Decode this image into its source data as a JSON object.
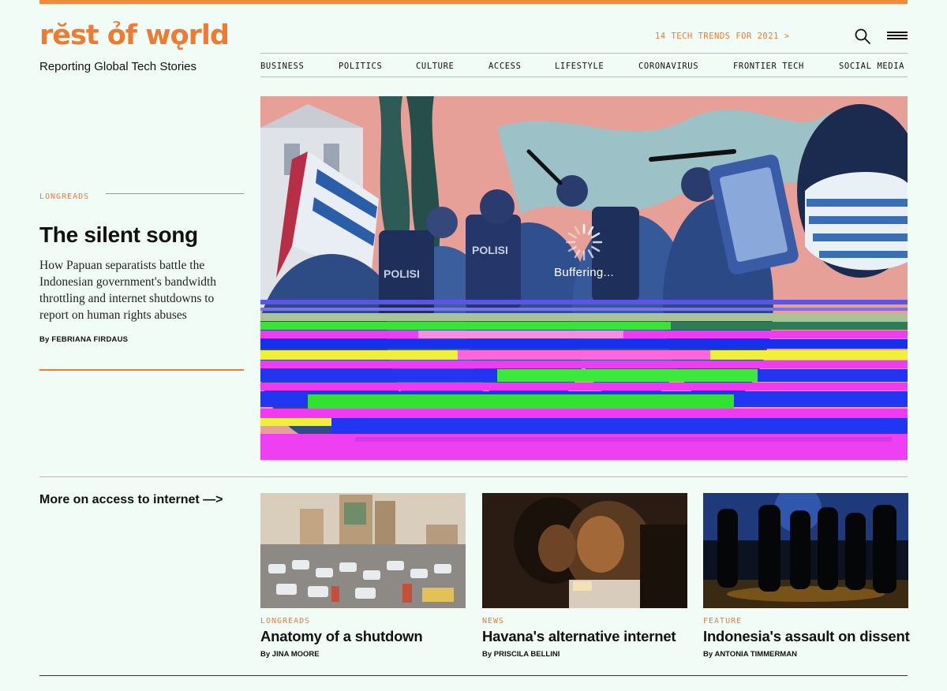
{
  "brand": {
    "logo_text": "rĕst ỏf wǫrld",
    "tagline": "Reporting Global Tech Stories",
    "accent_color": "#ef7b32"
  },
  "header": {
    "trend_link": "14 TECH TRENDS FOR 2021 >",
    "search_icon": "search-icon",
    "menu_icon": "hamburger-menu-icon"
  },
  "nav": {
    "items": [
      {
        "label": "BUSINESS"
      },
      {
        "label": "POLITICS"
      },
      {
        "label": "CULTURE"
      },
      {
        "label": "ACCESS"
      },
      {
        "label": "LIFESTYLE"
      },
      {
        "label": "CORONAVIRUS"
      },
      {
        "label": "FRONTIER TECH"
      },
      {
        "label": "SOCIAL MEDIA"
      }
    ]
  },
  "feature": {
    "kicker": "LONGREADS",
    "title": "The silent song",
    "dek": "How Papuan separatists battle the Indonesian government's bandwidth throttling and internet shutdowns to report on human rights abuses",
    "byline_prefix": "By",
    "author": "Febriana Firdaus",
    "video_status": "Buffering...",
    "sign_text": "POLISI"
  },
  "more": {
    "label": "More on access to internet —>",
    "cards": [
      {
        "kicker": "LONGREADS",
        "title": "Anatomy of a shutdown",
        "byline_prefix": "By",
        "author": "Jina Moore"
      },
      {
        "kicker": "NEWS",
        "title": "Havana's alternative internet",
        "byline_prefix": "By",
        "author": "Priscila Bellini"
      },
      {
        "kicker": "FEATURE",
        "title": "Indonesia's assault on dissent",
        "byline_prefix": "By",
        "author": "Antonia Timmerman"
      }
    ]
  }
}
